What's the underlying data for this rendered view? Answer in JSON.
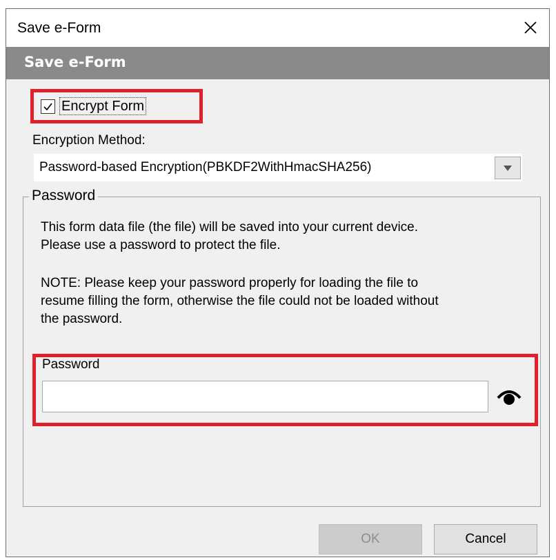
{
  "window": {
    "title": "Save e-Form"
  },
  "header": {
    "title": "Save e-Form"
  },
  "encrypt": {
    "label": "Encrypt Form",
    "checked": true
  },
  "encryption_method": {
    "label": "Encryption Method:",
    "selected": "Password-based Encryption(PBKDF2WithHmacSHA256)"
  },
  "password_group": {
    "legend": "Password",
    "info_line_1": "This form data file (the file) will be saved into your current device.",
    "info_line_2": "Please use a password to protect the file.",
    "note_line_1": "NOTE: Please keep your password properly for loading the file to",
    "note_line_2": "resume filling the form, otherwise the file could not be loaded without",
    "note_line_3": "the password.",
    "field_label": "Password",
    "field_value": ""
  },
  "buttons": {
    "ok": "OK",
    "cancel": "Cancel"
  },
  "colors": {
    "highlight": "#e0202a",
    "header_band": "#8a8a8a"
  }
}
